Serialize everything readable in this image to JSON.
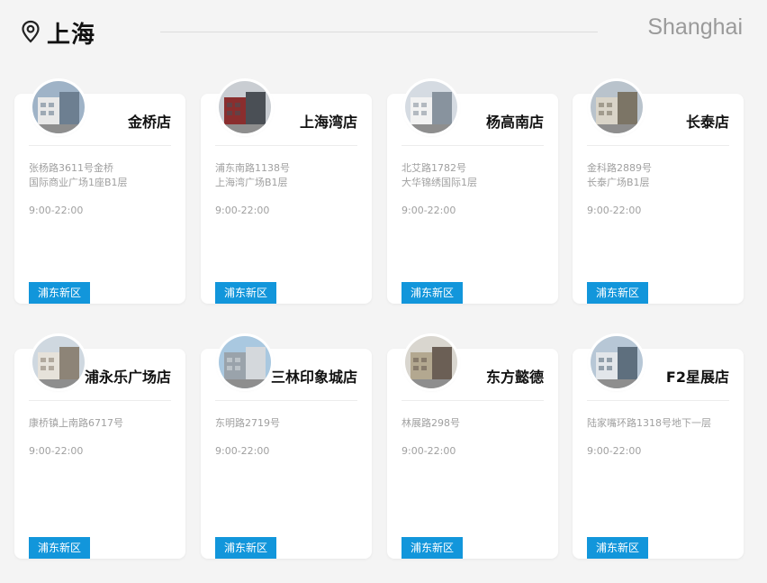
{
  "header": {
    "city_cn": "上海",
    "city_en": "Shanghai",
    "icon": "location-pin-icon"
  },
  "colors": {
    "badge_bg": "#1296db",
    "background": "#f4f4f4",
    "muted_text": "#a0a0a0"
  },
  "stores": [
    {
      "name": "金桥店",
      "address": [
        "张杨路3611号金桥",
        "国际商业广场1座B1层"
      ],
      "hours": "9:00-22:00",
      "district": "浦东新区"
    },
    {
      "name": "上海湾店",
      "address": [
        "浦东南路1138号",
        "上海湾广场B1层"
      ],
      "hours": "9:00-22:00",
      "district": "浦东新区"
    },
    {
      "name": "杨高南店",
      "address": [
        "北艾路1782号",
        "大华锦绣国际1层"
      ],
      "hours": "9:00-22:00",
      "district": "浦东新区"
    },
    {
      "name": "长泰店",
      "address": [
        "金科路2889号",
        "长泰广场B1层"
      ],
      "hours": "9:00-22:00",
      "district": "浦东新区"
    },
    {
      "name": "浦永乐广场店",
      "address": [
        "康桥镇上南路6717号"
      ],
      "hours": "9:00-22:00",
      "district": "浦东新区"
    },
    {
      "name": "三林印象城店",
      "address": [
        "东明路2719号"
      ],
      "hours": "9:00-22:00",
      "district": "浦东新区"
    },
    {
      "name": "东方懿德",
      "address": [
        "林展路298号"
      ],
      "hours": "9:00-22:00",
      "district": "浦东新区"
    },
    {
      "name": "F2星展店",
      "address": [
        "陆家嘴环路1318号地下一层"
      ],
      "hours": "9:00-22:00",
      "district": "浦东新区"
    }
  ]
}
